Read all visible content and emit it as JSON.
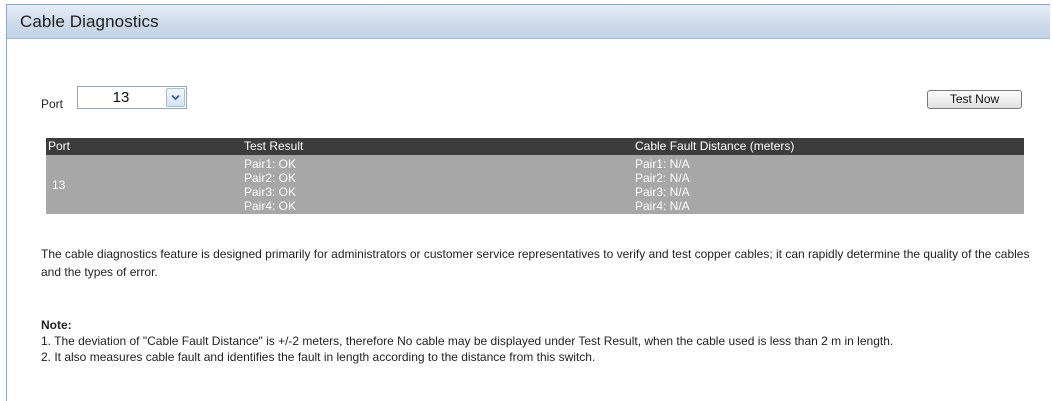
{
  "page": {
    "title": "Cable Diagnostics"
  },
  "form": {
    "port_label": "Port",
    "port_value": "13",
    "test_button_label": "Test Now"
  },
  "table": {
    "headers": [
      "Port",
      "Test Result",
      "Cable Fault Distance (meters)"
    ],
    "rows": [
      {
        "port": "13",
        "results": [
          "Pair1: OK",
          "Pair2: OK",
          "Pair3: OK",
          "Pair4: OK"
        ],
        "distances": [
          "Pair1: N/A",
          "Pair2: N/A",
          "Pair3: N/A",
          "Pair4: N/A"
        ]
      }
    ]
  },
  "description": "The cable diagnostics feature is designed primarily for administrators or customer service representatives to verify and test copper cables; it can rapidly determine the quality of the cables and the types of error.",
  "note": {
    "heading": "Note:",
    "lines": [
      "1. The deviation of \"Cable Fault Distance\" is +/-2 meters, therefore No cable may be displayed under Test Result, when the cable used is less than 2 m in length.",
      "2. It also measures cable fault and identifies the fault in length according to the distance from this switch."
    ]
  },
  "colors": {
    "header_bg": "#3c3c3c",
    "row_bg": "#a7a7a7",
    "title_bar": "#cfdbeb"
  },
  "icons": {
    "dropdown": "chevron-down-icon"
  }
}
